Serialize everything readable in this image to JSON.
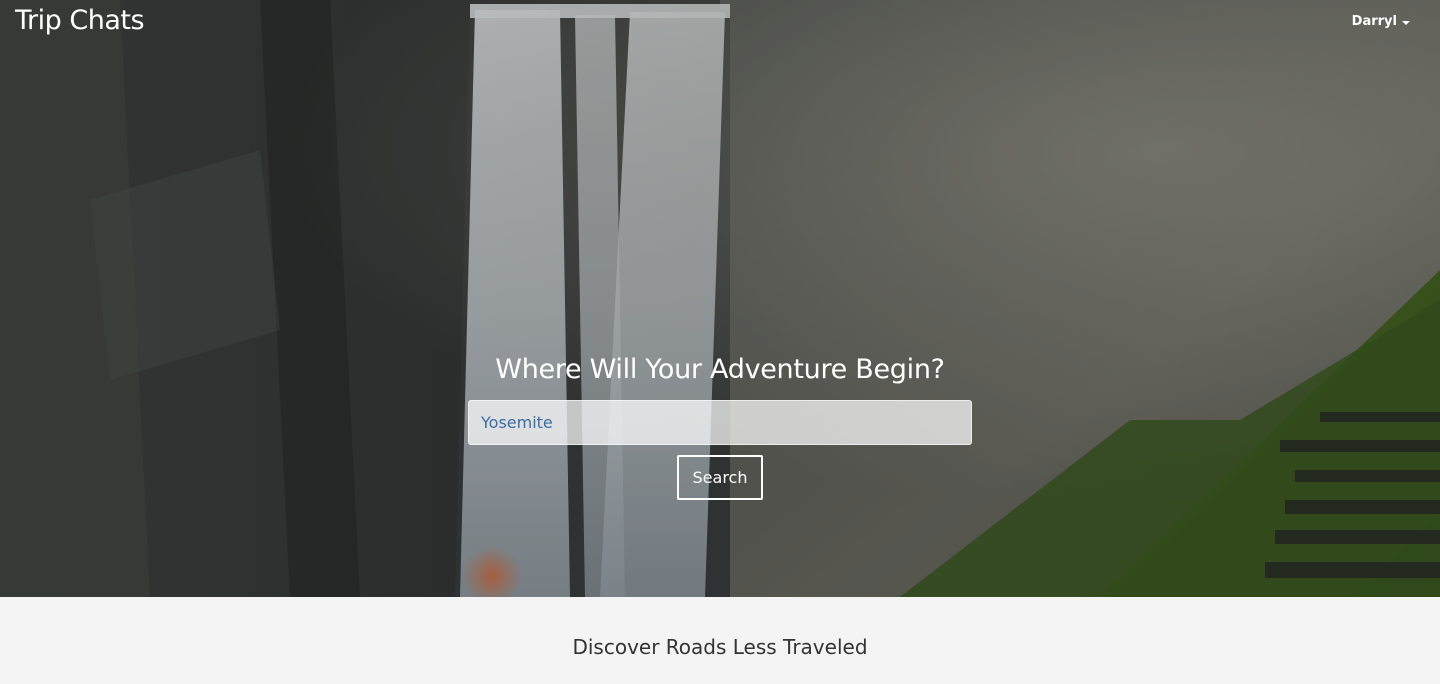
{
  "navbar": {
    "brand": "Trip Chats",
    "user_menu_label": "Darryl"
  },
  "hero": {
    "title": "Where Will Your Adventure Begin?",
    "search_value": "Yosemite",
    "search_button_label": "Search"
  },
  "section": {
    "heading": "Discover Roads Less Traveled"
  },
  "colors": {
    "lower_background": "#f4f4f4",
    "input_text": "#3b6ea5",
    "hero_text": "#ffffff"
  }
}
